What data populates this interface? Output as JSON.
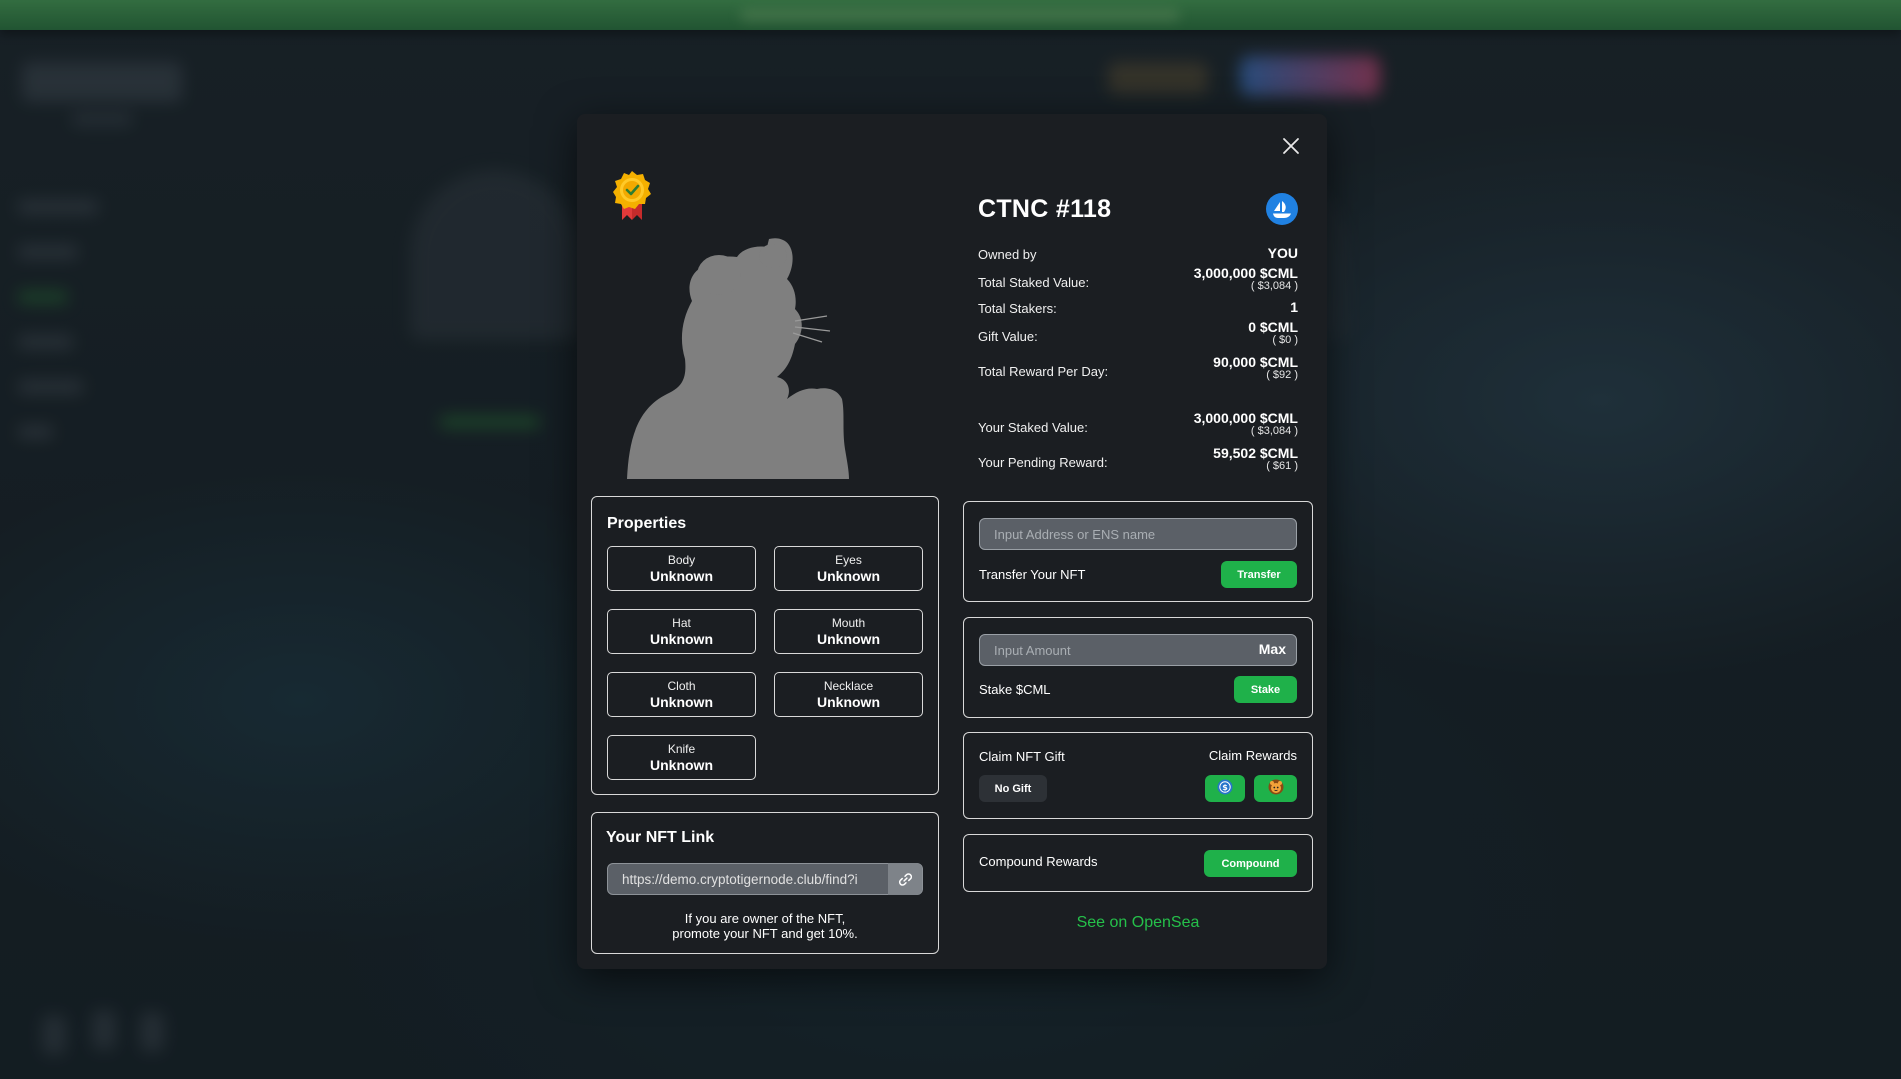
{
  "modal": {
    "title": "CTNC #118",
    "stats": [
      {
        "label": "Owned by",
        "value": "YOU",
        "usd": ""
      },
      {
        "label": "Total Staked Value:",
        "value": "3,000,000 $CML",
        "usd": "( $3,084 )"
      },
      {
        "label": "Total Stakers:",
        "value": "1",
        "usd": ""
      },
      {
        "label": "Gift Value:",
        "value": "0 $CML",
        "usd": "( $0 )"
      },
      {
        "label": "Total Reward Per Day:",
        "value": "90,000 $CML",
        "usd": "( $92 )"
      },
      {
        "label": "Your Staked Value:",
        "value": "3,000,000 $CML",
        "usd": "( $3,084 )"
      },
      {
        "label": "Your Pending Reward:",
        "value": "59,502 $CML",
        "usd": "( $61 )"
      }
    ],
    "properties": {
      "title": "Properties",
      "items": [
        {
          "key": "Body",
          "value": "Unknown"
        },
        {
          "key": "Eyes",
          "value": "Unknown"
        },
        {
          "key": "Hat",
          "value": "Unknown"
        },
        {
          "key": "Mouth",
          "value": "Unknown"
        },
        {
          "key": "Cloth",
          "value": "Unknown"
        },
        {
          "key": "Necklace",
          "value": "Unknown"
        },
        {
          "key": "Knife",
          "value": "Unknown"
        }
      ]
    },
    "nft_link": {
      "title": "Your NFT Link",
      "url": "https://demo.cryptotigernode.club/find?i",
      "note_line1": "If you are owner of the NFT,",
      "note_line2": "promote your NFT and get 10%."
    },
    "transfer": {
      "placeholder": "Input Address or ENS name",
      "label": "Transfer Your NFT",
      "button": "Transfer"
    },
    "stake": {
      "placeholder": "Input Amount",
      "max": "Max",
      "label": "Stake $CML",
      "button": "Stake"
    },
    "claim": {
      "gift_label": "Claim NFT Gift",
      "gift_button": "No Gift",
      "rewards_label": "Claim Rewards"
    },
    "compound": {
      "label": "Compound Rewards",
      "button": "Compound"
    },
    "opensea_link": "See on OpenSea"
  },
  "colors": {
    "accent_green": "#1fb14a",
    "link_green": "#25c04a",
    "modal_bg": "#1b1e22",
    "opensea_blue": "#2081e2"
  },
  "icons": [
    "close-icon",
    "verified-badge-icon",
    "opensea-icon",
    "link-icon",
    "usdc-coin-icon",
    "tiger-token-icon"
  ]
}
